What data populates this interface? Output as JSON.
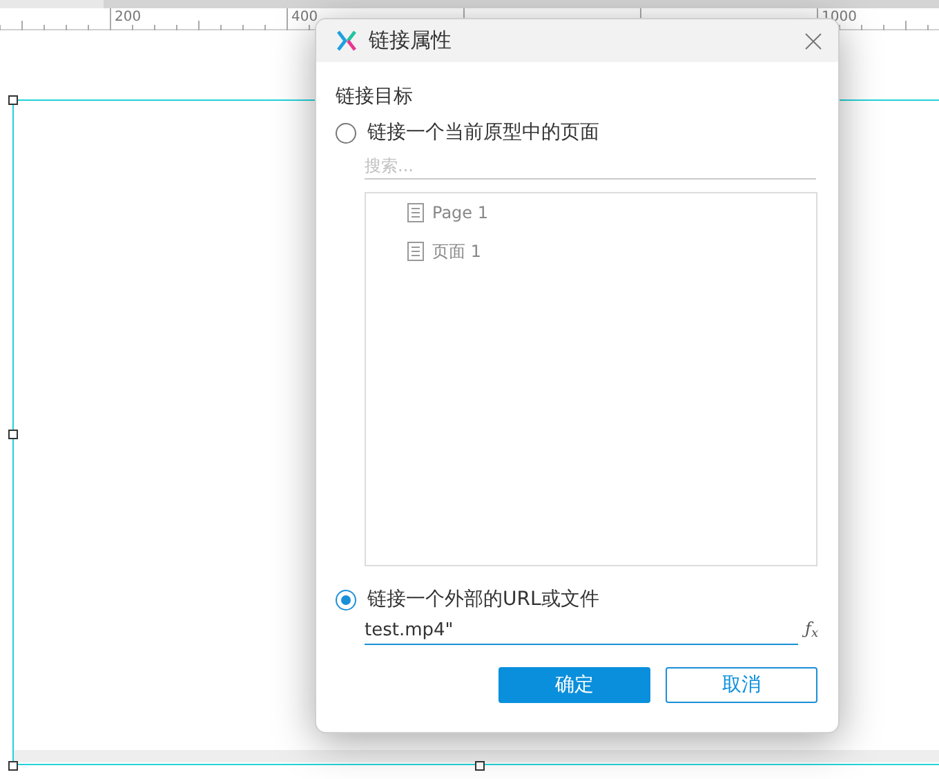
{
  "ruler": {
    "labels": [
      "200",
      "400",
      "1000"
    ]
  },
  "dialog": {
    "title": "链接属性",
    "section_label": "链接目标",
    "options": [
      {
        "label": "链接一个当前原型中的页面",
        "selected": false
      },
      {
        "label": "链接一个外部的URL或文件",
        "selected": true
      }
    ],
    "search": {
      "placeholder": "搜索..."
    },
    "pages": [
      {
        "name": "Page 1"
      },
      {
        "name": "页面 1"
      }
    ],
    "url": {
      "value": "test.mp4\"",
      "formula_button": "ƒ$_{x}$"
    },
    "buttons": [
      {
        "label": "确定",
        "kind": "primary"
      },
      {
        "label": "取消",
        "kind": "secondary"
      }
    ]
  }
}
